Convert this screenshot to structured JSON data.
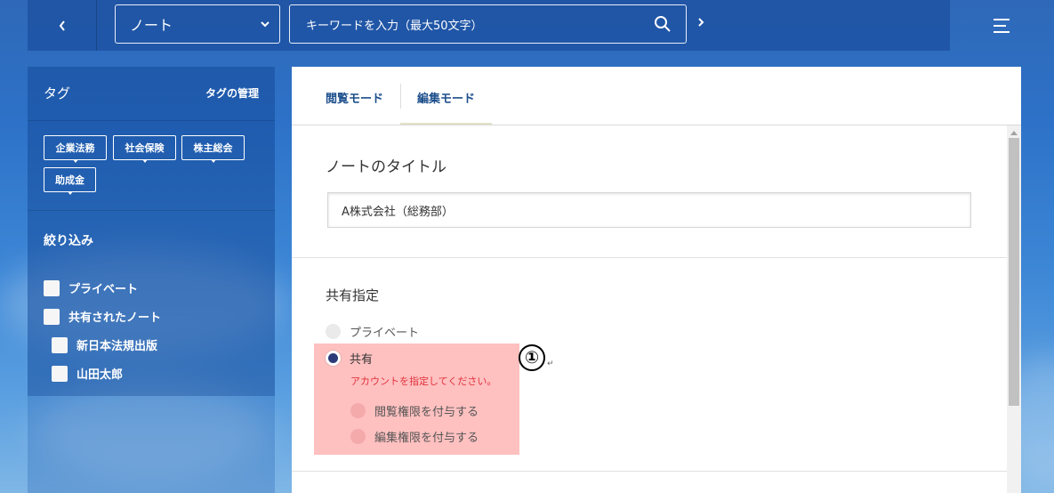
{
  "topbar": {
    "back_icon": "chevron-left-icon",
    "category_select": {
      "value": "ノート",
      "icon": "chevron-down-icon"
    },
    "search": {
      "placeholder": "キーワードを入力（最大50文字）",
      "icon": "search-icon"
    },
    "forward_icon": "chevron-right-icon",
    "menu_icon": "hamburger-menu-icon"
  },
  "sidebar": {
    "tags_title": "タグ",
    "tags_manage_label": "タグの管理",
    "tags": [
      "企業法務",
      "社会保険",
      "株主総会",
      "助成金"
    ],
    "filter_title": "絞り込み",
    "filters": [
      {
        "label": "プライベート",
        "checked": false
      },
      {
        "label": "共有されたノート",
        "checked": false
      },
      {
        "label": "新日本法規出版",
        "checked": false
      },
      {
        "label": "山田太郎",
        "checked": false
      }
    ]
  },
  "main": {
    "tabs": [
      {
        "label": "閲覧モード",
        "active": false
      },
      {
        "label": "編集モード",
        "active": true
      }
    ],
    "title_section": {
      "label": "ノートのタイトル",
      "value": "A株式会社（総務部）"
    },
    "share_section": {
      "label": "共有指定",
      "options": [
        {
          "label": "プライベート",
          "selected": false
        },
        {
          "label": "共有",
          "selected": true
        }
      ],
      "warning": "アカウントを指定してください。",
      "permissions": [
        {
          "label": "閲覧権限を付与する",
          "selected": false
        },
        {
          "label": "編集権限を付与する",
          "selected": false
        }
      ]
    }
  },
  "annotation": {
    "number_label": "①",
    "return_mark": "↵"
  },
  "colors": {
    "sky": "#2d72c8",
    "highlight": "#ffc0c0",
    "warning": "#e0333d",
    "tab_text": "#1d4f8c",
    "radio_selected": "#2b3b7a"
  }
}
